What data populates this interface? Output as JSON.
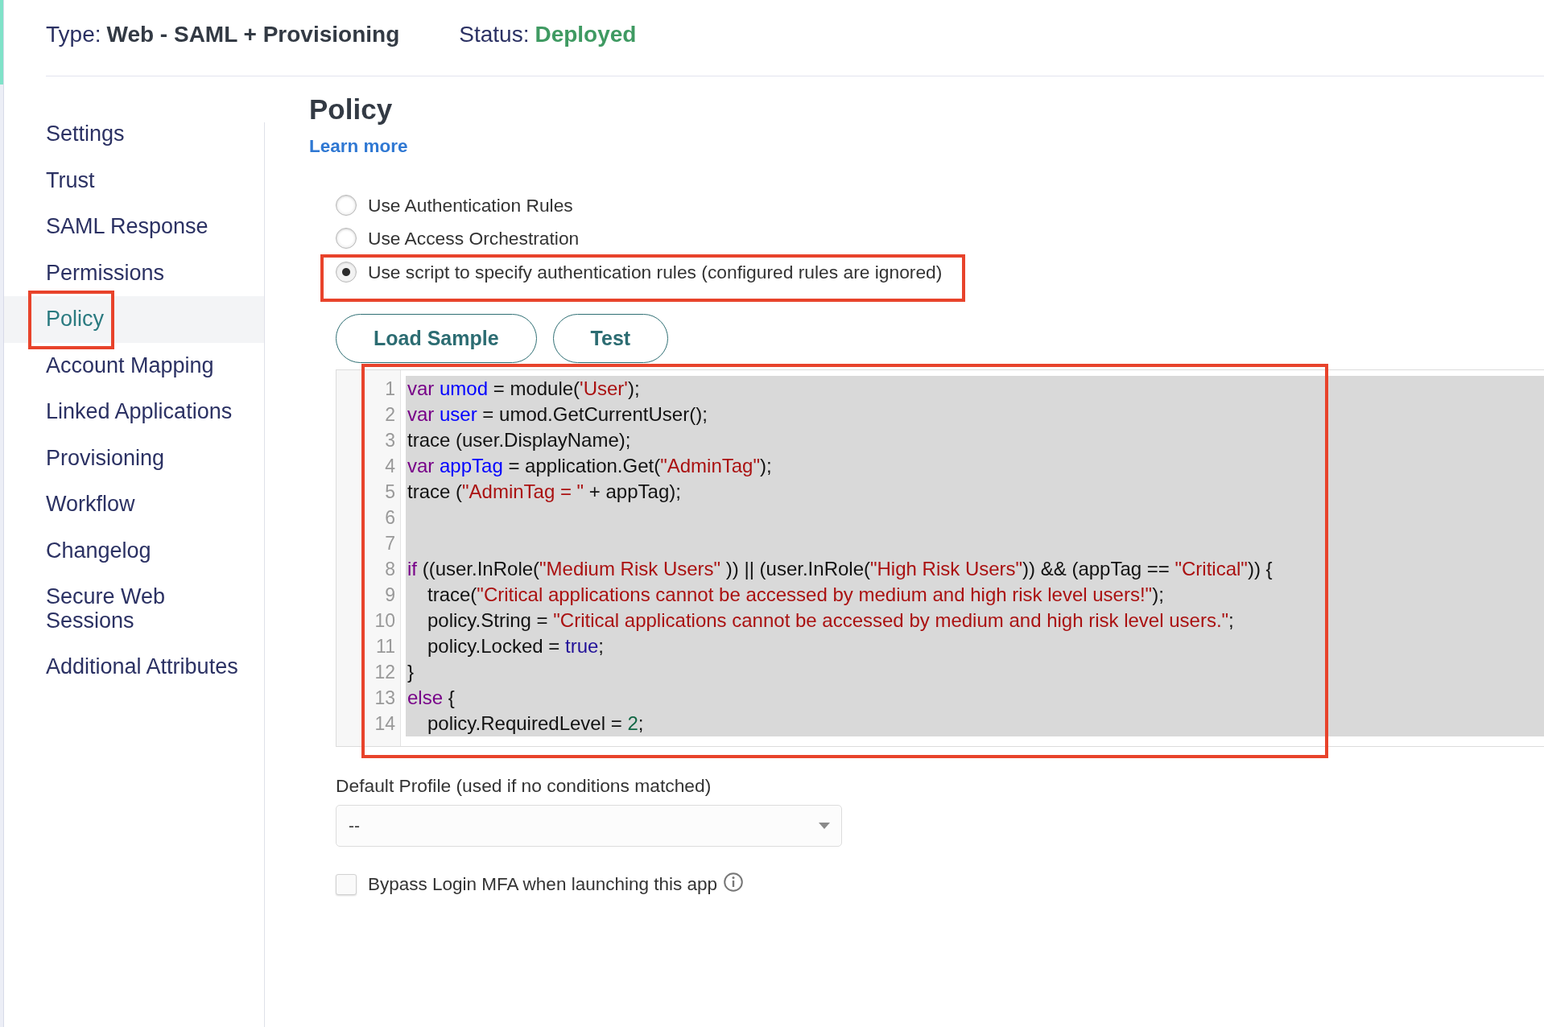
{
  "header": {
    "type_label": "Type:",
    "type_value": "Web - SAML + Provisioning",
    "status_label": "Status:",
    "status_value": "Deployed"
  },
  "sidebar": {
    "items": [
      {
        "label": "Settings",
        "selected": false,
        "highlighted": false
      },
      {
        "label": "Trust",
        "selected": false,
        "highlighted": false
      },
      {
        "label": "SAML Response",
        "selected": false,
        "highlighted": false
      },
      {
        "label": "Permissions",
        "selected": false,
        "highlighted": false
      },
      {
        "label": "Policy",
        "selected": true,
        "highlighted": true
      },
      {
        "label": "Account Mapping",
        "selected": false,
        "highlighted": false
      },
      {
        "label": "Linked Applications",
        "selected": false,
        "highlighted": false
      },
      {
        "label": "Provisioning",
        "selected": false,
        "highlighted": false
      },
      {
        "label": "Workflow",
        "selected": false,
        "highlighted": false
      },
      {
        "label": "Changelog",
        "selected": false,
        "highlighted": false
      },
      {
        "label": "Secure Web\nSessions",
        "selected": false,
        "highlighted": false
      },
      {
        "label": "Additional Attributes",
        "selected": false,
        "highlighted": false
      }
    ]
  },
  "policy": {
    "title": "Policy",
    "learn_more": "Learn more",
    "options": [
      {
        "label": "Use Authentication Rules",
        "selected": false,
        "highlighted": false
      },
      {
        "label": "Use Access Orchestration",
        "selected": false,
        "highlighted": false
      },
      {
        "label": "Use script to specify authentication rules (configured rules are ignored)",
        "selected": true,
        "highlighted": true
      }
    ],
    "buttons": [
      "Load Sample",
      "Test"
    ],
    "script_editor": {
      "highlighted": true,
      "lines": [
        {
          "number": "1",
          "indented": false,
          "tokens": [
            {
              "kind": "keyword",
              "text": "var"
            },
            {
              "kind": "variable",
              "text": " umod"
            },
            {
              "kind": "plain",
              "text": " = module("
            },
            {
              "kind": "string",
              "text": "'User'"
            },
            {
              "kind": "plain",
              "text": ");"
            }
          ]
        },
        {
          "number": "2",
          "indented": false,
          "tokens": [
            {
              "kind": "keyword",
              "text": "var"
            },
            {
              "kind": "variable",
              "text": " user"
            },
            {
              "kind": "plain",
              "text": " = umod.GetCurrentUser();"
            }
          ]
        },
        {
          "number": "3",
          "indented": false,
          "tokens": [
            {
              "kind": "plain",
              "text": "trace (user.DisplayName);"
            }
          ]
        },
        {
          "number": "4",
          "indented": false,
          "tokens": [
            {
              "kind": "keyword",
              "text": "var"
            },
            {
              "kind": "variable",
              "text": " appTag"
            },
            {
              "kind": "plain",
              "text": " = application.Get("
            },
            {
              "kind": "string",
              "text": "\"AdminTag\""
            },
            {
              "kind": "plain",
              "text": ");"
            }
          ]
        },
        {
          "number": "5",
          "indented": false,
          "tokens": [
            {
              "kind": "plain",
              "text": "trace ("
            },
            {
              "kind": "string",
              "text": "\"AdminTag = \""
            },
            {
              "kind": "plain",
              "text": " + appTag);"
            }
          ]
        },
        {
          "number": "6"
        },
        {
          "number": "7"
        },
        {
          "number": "8",
          "indented": false,
          "tokens": [
            {
              "kind": "keyword",
              "text": "if"
            },
            {
              "kind": "plain",
              "text": " ((user.InRole("
            },
            {
              "kind": "string",
              "text": "\"Medium Risk Users\""
            },
            {
              "kind": "plain",
              "text": " )) || (user.InRole("
            },
            {
              "kind": "string",
              "text": "\"High Risk Users\""
            },
            {
              "kind": "plain",
              "text": ")) && (appTag == "
            },
            {
              "kind": "string",
              "text": "\"Critical\""
            },
            {
              "kind": "plain",
              "text": ")) {"
            }
          ]
        },
        {
          "number": "9",
          "indented": true,
          "tokens": [
            {
              "kind": "plain",
              "text": "trace("
            },
            {
              "kind": "string",
              "text": "\"Critical applications cannot be accessed by medium and high risk level users!\""
            },
            {
              "kind": "plain",
              "text": ");"
            }
          ]
        },
        {
          "number": "10",
          "indented": true,
          "tokens": [
            {
              "kind": "plain",
              "text": "policy.String = "
            },
            {
              "kind": "string",
              "text": "\"Critical applications cannot be accessed by medium and high risk level users.\""
            },
            {
              "kind": "plain",
              "text": ";"
            }
          ]
        },
        {
          "number": "11",
          "indented": true,
          "tokens": [
            {
              "kind": "plain",
              "text": "policy.Locked = "
            },
            {
              "kind": "atom",
              "text": "true"
            },
            {
              "kind": "plain",
              "text": ";"
            }
          ]
        },
        {
          "number": "12",
          "indented": false,
          "tokens": [
            {
              "kind": "plain",
              "text": "}"
            }
          ]
        },
        {
          "number": "13",
          "indented": false,
          "tokens": [
            {
              "kind": "keyword",
              "text": "else"
            },
            {
              "kind": "plain",
              "text": " {"
            }
          ]
        },
        {
          "number": "14",
          "indented": true,
          "tokens": [
            {
              "kind": "plain",
              "text": "policy.RequiredLevel = "
            },
            {
              "kind": "number",
              "text": "2"
            },
            {
              "kind": "plain",
              "text": ";"
            }
          ]
        }
      ]
    },
    "default_profile": {
      "label": "Default Profile (used if no conditions matched)",
      "value": "--"
    },
    "bypass_mfa": {
      "label": "Bypass Login MFA when launching this app",
      "checked": false
    }
  }
}
